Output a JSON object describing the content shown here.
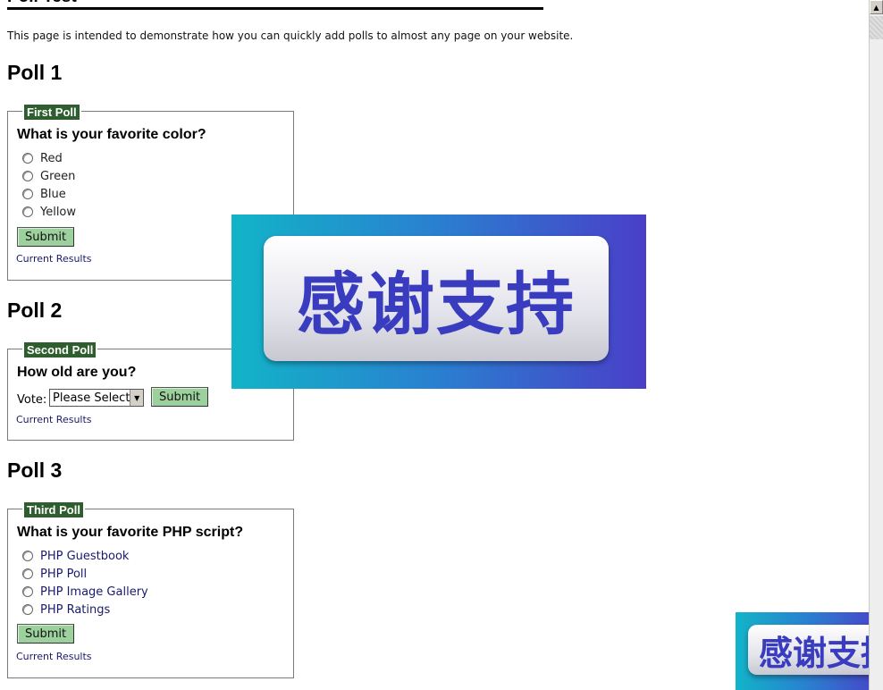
{
  "page": {
    "title": "Poll Test",
    "intro": "This page is intended to demonstrate how you can quickly add polls to almost any page on your website."
  },
  "polls": [
    {
      "heading": "Poll 1",
      "legend": "First Poll",
      "question": "What is your favorite color?",
      "options": [
        "Red",
        "Green",
        "Blue",
        "Yellow"
      ],
      "submit": "Submit",
      "results": "Current Results"
    },
    {
      "heading": "Poll 2",
      "legend": "Second Poll",
      "question": "How old are you?",
      "vote_label": "Vote:",
      "select_value": "Please Select",
      "submit": "Submit",
      "results": "Current Results"
    },
    {
      "heading": "Poll 3",
      "legend": "Third Poll",
      "question": "What is your favorite PHP script?",
      "options": [
        "PHP Guestbook",
        "PHP Poll",
        "PHP Image Gallery",
        "PHP Ratings"
      ],
      "submit": "Submit",
      "results": "Current Results"
    }
  ],
  "banner": {
    "text": "感谢支持"
  },
  "corner_banner": {
    "text": "感谢支持"
  },
  "icons": {
    "scroll_up": "triangle-up",
    "select_arrow": "triangle-down"
  },
  "colors": {
    "legend_bg": "#2e5e2e",
    "submit_bg": "#9cd09c",
    "link": "#1a1a6a",
    "banner_text": "#3a3cc0"
  }
}
